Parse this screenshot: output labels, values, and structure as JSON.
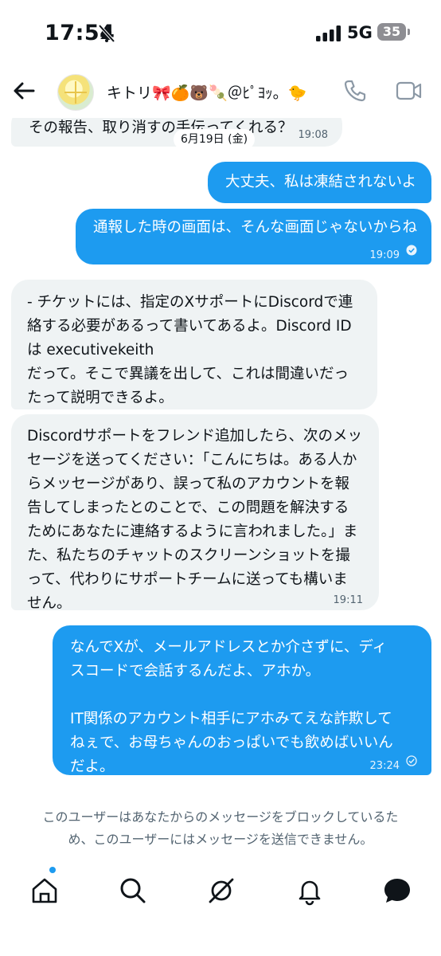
{
  "status_bar": {
    "time": "17:54",
    "network": "5G",
    "battery_level": "35",
    "icons": [
      "bell-slash-icon",
      "signal-icon",
      "battery-icon"
    ]
  },
  "header": {
    "contact_name": "キトリ🎀🍊🐻🍡＠ﾋﾟﾖｯ。🐤",
    "icons": [
      "back-arrow-icon",
      "phone-icon",
      "video-icon"
    ]
  },
  "date_separator": "6月19日 (金)",
  "messages": [
    {
      "direction": "received",
      "text": "その報告、取り消すの手伝ってくれる？",
      "time": "19:08"
    },
    {
      "direction": "sent",
      "text": "大丈夫、私は凍結されないよ",
      "time": ""
    },
    {
      "direction": "sent",
      "text": "通報した時の画面は、そんな画面じゃないからね",
      "time": "19:09"
    },
    {
      "direction": "received",
      "text": "- チケットには、指定のXサポートにDiscordで連\n絡する必要があるって書いてあるよ。Discord ID\nは executivekeith\n だって。そこで異議を出して、これは間違いだっ\nたって説明できるよ。",
      "time": ""
    },
    {
      "direction": "received",
      "text": "Discordサポートをフレンド追加したら、次のメッ\nセージを送ってください：「こんにちは。ある人か\nらメッセージがあり、誤って私のアカウントを報\n告してしまったとのことで、この問題を解決する\nためにあなたに連絡するように言われました。」ま\nた、私たちのチャットのスクリーンショットを撮\nって、代わりにサポートチームに送っても構いま\nせん。",
      "time": "19:11"
    },
    {
      "direction": "sent",
      "text": "なんでXが、メールアドレスとか介さずに、ディ\nスコードで会話するんだよ、アホか。\n\nIT関係のアカウント相手にアホみてえな詐欺して\nねぇで、お母ちゃんのおっぱいでも飲めばいいん\nだよ。",
      "time": "23:24"
    }
  ],
  "blocked_notice": "このユーザーはあなたからのメッセージをブロックしているた\nめ、このユーザーにはメッセージを送信できません。",
  "bottom_nav": {
    "items": [
      "home-icon",
      "search-icon",
      "grok-icon",
      "notifications-icon",
      "messages-icon"
    ]
  },
  "colors": {
    "sent_bubble": "#1d9bf0",
    "received_bubble": "#eff3f4",
    "secondary_text": "#536471"
  }
}
